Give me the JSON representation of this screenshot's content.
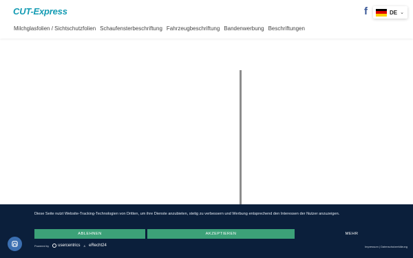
{
  "header": {
    "logo": "CUT-Express",
    "facebook_icon": "facebook-icon",
    "language": {
      "label": "DE",
      "flag": "germany-flag-icon"
    }
  },
  "nav": {
    "items": [
      {
        "label": "Milchglasfolien / Sichtschutzfolien"
      },
      {
        "label": "Schaufensterbeschriftung"
      },
      {
        "label": "Fahrzeugbeschriftung"
      },
      {
        "label": "Bandenwerbung"
      },
      {
        "label": "Beschriftungen"
      }
    ]
  },
  "consent": {
    "text": "Diese Seite nutzt Website-Tracking-Technologien von Dritten, um ihre Dienste anzubieten, stetig zu verbessern und Werbung entsprechend den Interessen der Nutzer anzuzeigen.",
    "deny_label": "ABLEHNEN",
    "accept_label": "AKZEPTIEREN",
    "more_label": "MEHR",
    "powered_by": "Powered by",
    "usercentrics": "usercentrics",
    "amp": "&",
    "erecht": "eRecht24",
    "legal": "Impressum | Datenschutzerklärung"
  },
  "colors": {
    "brand": "#139bb3",
    "consent_bg": "#0b1f3b",
    "button_green": "#3ca178",
    "fab_blue": "#3b6fb1"
  }
}
